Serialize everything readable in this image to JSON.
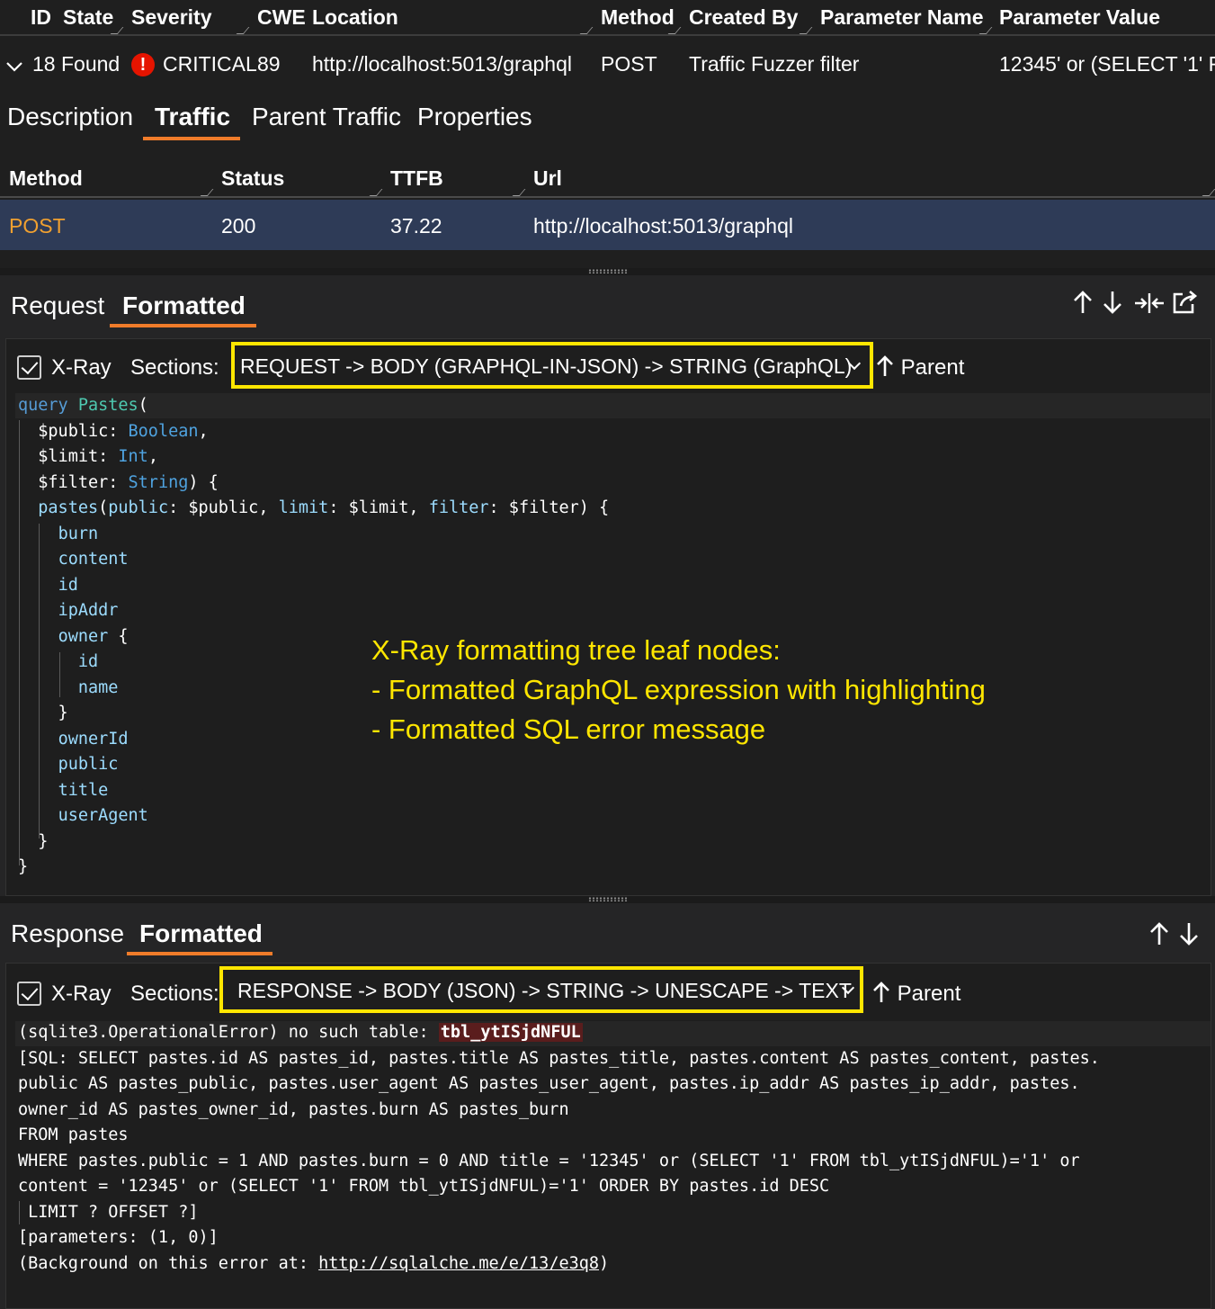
{
  "findings": {
    "columns": [
      "ID",
      "State",
      "Severity",
      "CWE",
      "Location",
      "Method",
      "Created By",
      "Parameter Name",
      "Parameter Value"
    ],
    "row": {
      "found": "18 Found",
      "severity": "CRITICAL",
      "cwe": "89",
      "location": "http://localhost:5013/graphql",
      "method": "POST",
      "created_by": "Traffic Fuzzer",
      "parameter_name": "filter",
      "parameter_value": "12345' or (SELECT '1' F"
    }
  },
  "detail_tabs": [
    "Description",
    "Traffic",
    "Parent Traffic",
    "Properties"
  ],
  "active_detail_tab": "Traffic",
  "traffic": {
    "columns": [
      "Method",
      "Status",
      "TTFB",
      "Url"
    ],
    "rows": [
      {
        "method": "POST",
        "status": "200",
        "ttfb": "37.22",
        "url": "http://localhost:5013/graphql"
      }
    ]
  },
  "request": {
    "tabs": [
      "Request",
      "Formatted"
    ],
    "active_tab": "Formatted",
    "xray_label": "X-Ray",
    "sections_label": "Sections:",
    "section_value": "REQUEST -> BODY (GRAPHQL-IN-JSON) -> STRING (GraphQL)",
    "parent_label": "Parent",
    "toolbar_icons": [
      "arrow-up-icon",
      "arrow-down-icon",
      "split-icon",
      "export-icon"
    ],
    "code_lines": [
      "query Pastes(",
      "$public: Boolean,",
      "$limit: Int,",
      "$filter: String) {",
      "pastes(public: $public, limit: $limit, filter: $filter) {",
      "burn",
      "content",
      "id",
      "ipAddr",
      "owner {",
      "id",
      "name",
      "}",
      "ownerId",
      "public",
      "title",
      "userAgent",
      "}",
      "}"
    ]
  },
  "annotation": {
    "line1": "X-Ray formatting tree leaf nodes:",
    "line2": "- Formatted GraphQL expression with highlighting",
    "line3": "- Formatted SQL error message"
  },
  "response": {
    "tabs": [
      "Response",
      "Formatted"
    ],
    "active_tab": "Formatted",
    "xray_label": "X-Ray",
    "sections_label": "Sections:",
    "section_value": "RESPONSE -> BODY (JSON) -> STRING -> UNESCAPE -> TEXT",
    "parent_label": "Parent",
    "toolbar_icons": [
      "arrow-up-icon",
      "arrow-down-icon"
    ],
    "error_prefix": "(sqlite3.OperationalError) no such table: ",
    "error_table": "tbl_ytISjdNFUL",
    "lines": [
      "[SQL: SELECT pastes.id AS pastes_id, pastes.title AS pastes_title, pastes.content AS pastes_content, pastes.",
      "public AS pastes_public, pastes.user_agent AS pastes_user_agent, pastes.ip_addr AS pastes_ip_addr, pastes.",
      "owner_id AS pastes_owner_id, pastes.burn AS pastes_burn",
      "FROM pastes",
      "WHERE pastes.public = 1 AND pastes.burn = 0 AND title = '12345' or (SELECT '1' FROM tbl_ytISjdNFUL)='1' or",
      "content = '12345' or (SELECT '1' FROM tbl_ytISjdNFUL)='1' ORDER BY pastes.id DESC",
      " LIMIT ? OFFSET ?]",
      "[parameters: (1, 0)]"
    ],
    "background_prefix": "(Background on this error at: ",
    "background_link": "http://sqlalche.me/e/13/e3q8",
    "background_suffix": ")"
  }
}
